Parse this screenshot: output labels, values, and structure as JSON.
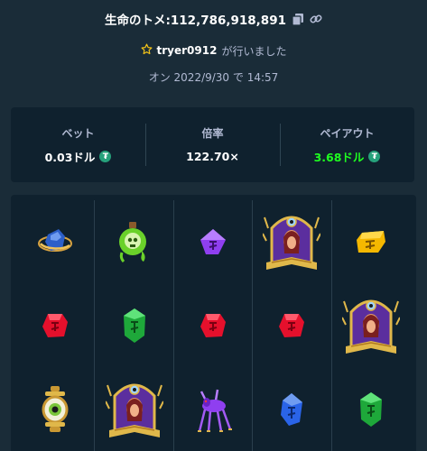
{
  "header": {
    "title": "生命のトメ:112,786,918,891",
    "player": "tryer0912",
    "played_suffix": "が行いました",
    "date": "オン 2022/9/30 で 14:57"
  },
  "stats": {
    "bet_label": "ベット",
    "bet_value": "0.03ドル",
    "multiplier_label": "倍率",
    "multiplier_value": "122.70×",
    "payout_label": "ペイアウト",
    "payout_value": "3.68ドル",
    "currency_icon": "tether-coin-icon",
    "payout_color": "#1fff20"
  },
  "board": {
    "columns": [
      [
        "blue-stone-ring-icon",
        "red-rune-gem-icon",
        "eye-lantern-icon"
      ],
      [
        "green-skull-potion-icon",
        "green-rune-gem-icon",
        "spider-priestess-book-icon"
      ],
      [
        "purple-rune-gem-icon",
        "red-rune-gem-icon",
        "purple-spider-creature-icon"
      ],
      [
        "spider-priestess-book-icon",
        "red-rune-gem-icon",
        "blue-rune-gem-icon"
      ],
      [
        "yellow-rune-gem-icon",
        "spider-priestess-book-icon",
        "green-rune-gem-icon"
      ]
    ]
  }
}
